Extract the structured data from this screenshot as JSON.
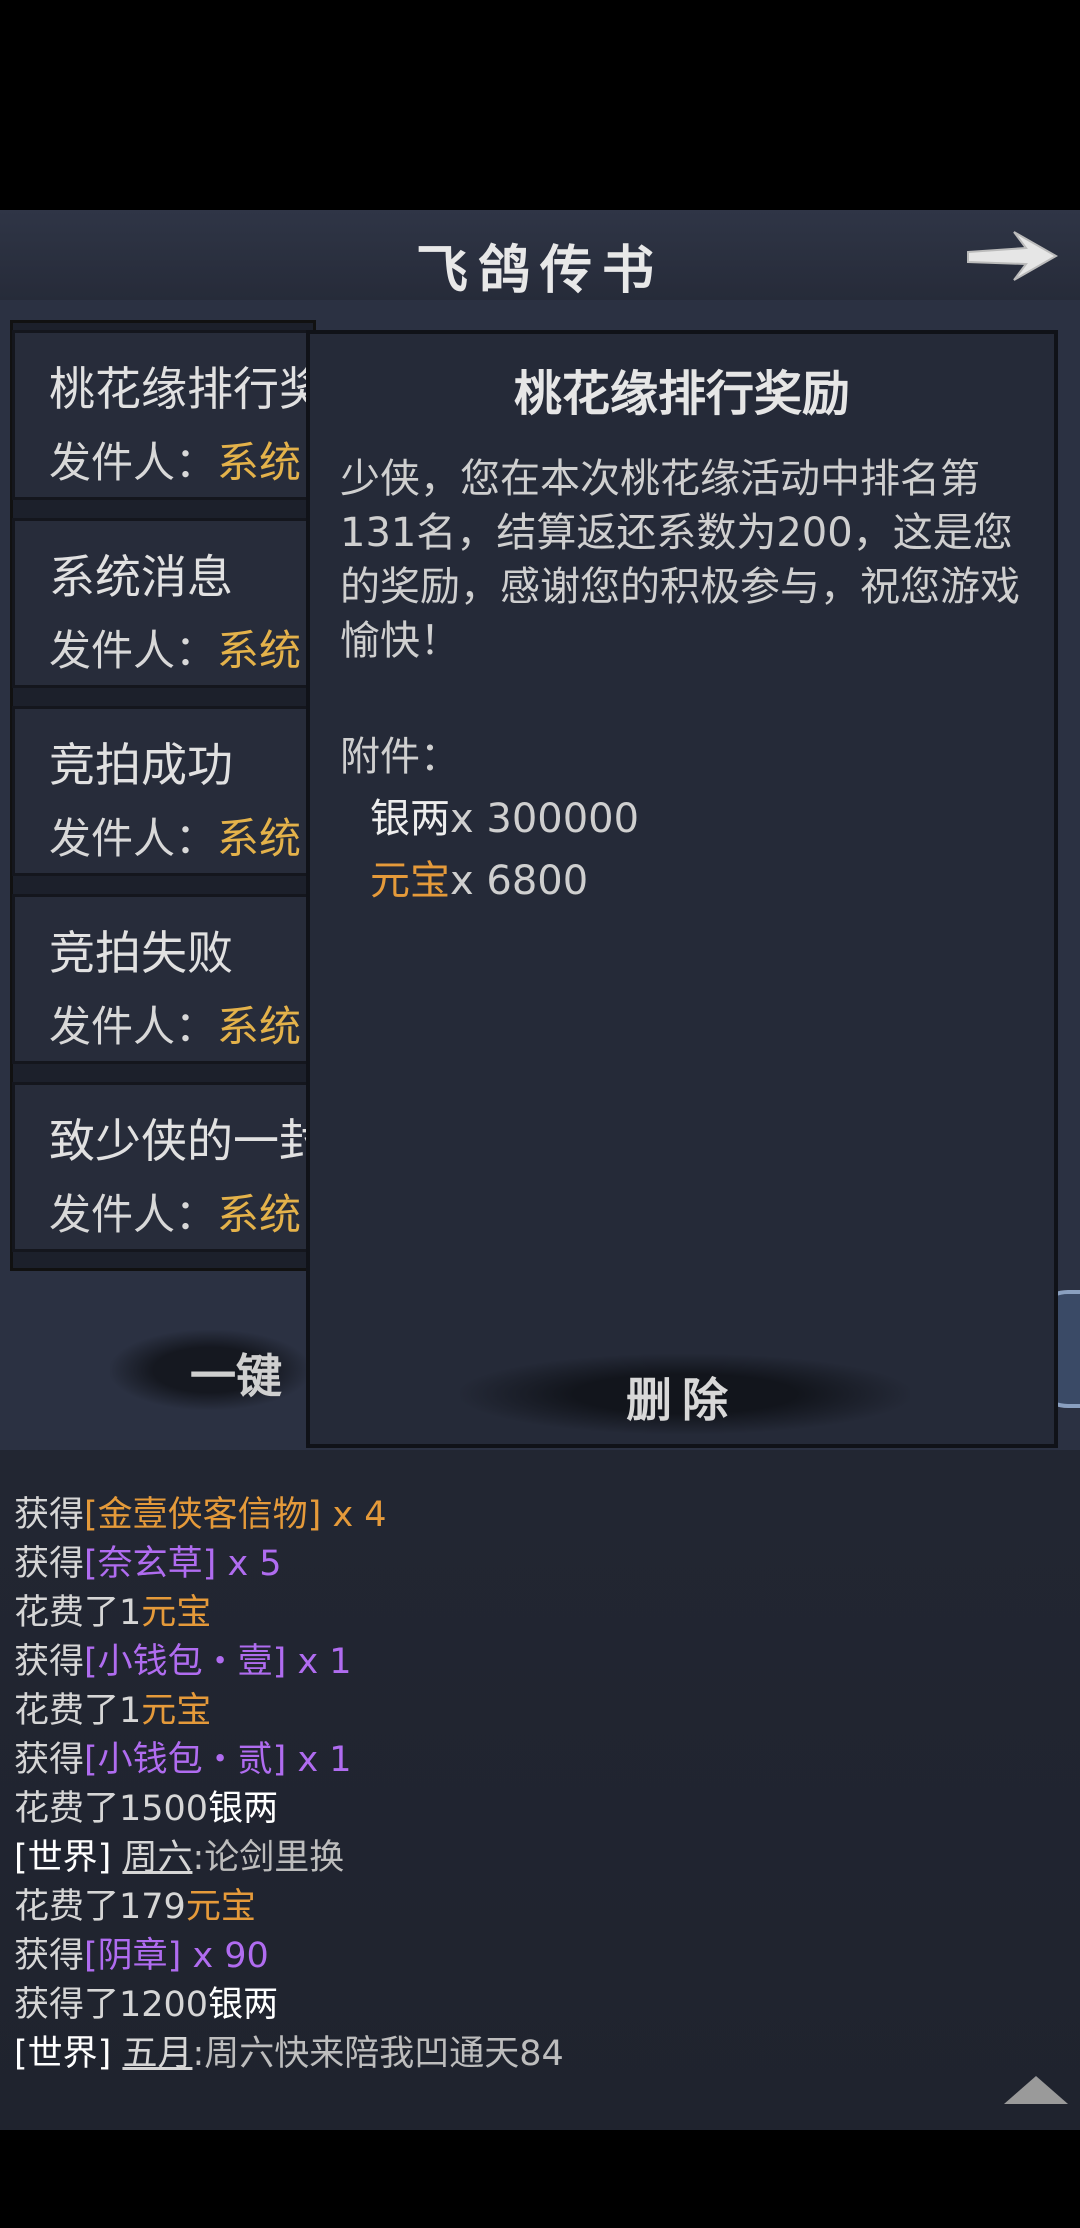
{
  "header": {
    "title": "飞鸽传书"
  },
  "mail_list": {
    "sender_label": "发件人：",
    "items": [
      {
        "title": "桃花缘排行奖励",
        "sender": "系统"
      },
      {
        "title": "系统消息",
        "sender": "系统"
      },
      {
        "title": "竞拍成功",
        "sender": "系统"
      },
      {
        "title": "竞拍失败",
        "sender": "系统"
      },
      {
        "title": "致少侠的一封信",
        "sender": "系统"
      }
    ],
    "onekey_label": "一键"
  },
  "detail": {
    "title": "桃花缘排行奖励",
    "body": "少侠，您在本次桃花缘活动中排名第131名，结算返还系数为200，这是您的奖励，感谢您的积极参与，祝您游戏愉快！",
    "attachment_label": "附件：",
    "attachments": [
      {
        "name": "银两",
        "qty": "x 300000"
      },
      {
        "name": "元宝",
        "qty": "x 6800"
      }
    ],
    "delete_label": "删除"
  },
  "chat": {
    "lines": [
      {
        "a": "获得",
        "b": "[金壹侠客信物]",
        "c": " x 4"
      },
      {
        "a": "获得",
        "b": "[奈玄草]",
        "c": " x 5"
      },
      {
        "a": "花费了1",
        "b": "元宝",
        "c": ""
      },
      {
        "a": "获得",
        "b": "[小钱包・壹]",
        "c": " x 1"
      },
      {
        "a": "花费了1",
        "b": "元宝",
        "c": ""
      },
      {
        "a": "获得",
        "b": "[小钱包・贰]",
        "c": " x 1"
      },
      {
        "a": "花费了1500",
        "b": "银两",
        "c": ""
      },
      {
        "a": "[世界] ",
        "b": "周六",
        "c": ":论剑里换"
      },
      {
        "a": "花费了179",
        "b": "元宝",
        "c": ""
      },
      {
        "a": "获得",
        "b": "[阴章]",
        "c": " x 90"
      },
      {
        "a": "获得了1200",
        "b": "银两",
        "c": ""
      },
      {
        "a": "[世界] ",
        "b": "五月",
        "c": ":周六快来陪我凹通天84"
      }
    ]
  },
  "colors": {
    "gold_sender": "#e4b24a",
    "orange_item": "#e59a3a",
    "purple_item": "#b06cf0"
  }
}
